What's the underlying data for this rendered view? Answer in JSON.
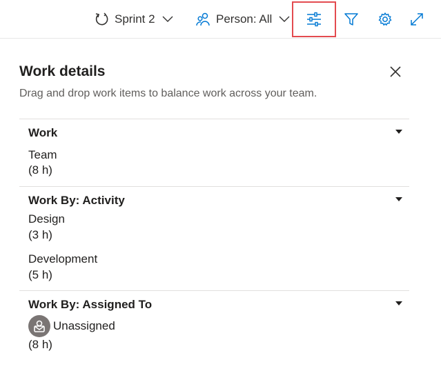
{
  "toolbar": {
    "sprint_label": "Sprint 2",
    "person_label": "Person: All"
  },
  "panel": {
    "title": "Work details",
    "description": "Drag and drop work items to balance work across your team.",
    "sections": [
      {
        "title": "Work",
        "rows": [
          {
            "label": "Team",
            "value": "(8 h)"
          }
        ]
      },
      {
        "title": "Work By: Activity",
        "rows": [
          {
            "label": "Design",
            "value": "(3 h)"
          },
          {
            "label": "Development",
            "value": "(5 h)"
          }
        ]
      },
      {
        "title": "Work By: Assigned To",
        "rows": [
          {
            "label": "Unassigned",
            "value": "(8 h)",
            "avatar": "unassigned-avatar"
          }
        ]
      }
    ]
  },
  "colors": {
    "accent": "#0078d4",
    "highlight_border": "#e34a4f",
    "avatar_bg": "#7a7574"
  }
}
